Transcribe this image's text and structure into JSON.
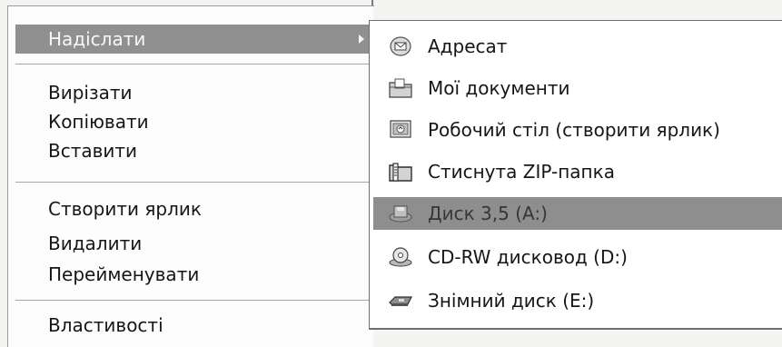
{
  "context_menu": {
    "send_to_label": "Надіслати",
    "cut_label": "Вирізати",
    "copy_label": "Копіювати",
    "paste_label": "Вставити",
    "create_shortcut_label": "Створити ярлик",
    "delete_label": "Видалити",
    "rename_label": "Перейменувати",
    "properties_label": "Властивості"
  },
  "send_to_submenu": {
    "items": [
      {
        "label": "Адресат",
        "icon": "mail-recipient-icon"
      },
      {
        "label": "Мої документи",
        "icon": "folder-icon"
      },
      {
        "label": "Робочий стіл (створити ярлик)",
        "icon": "desktop-icon"
      },
      {
        "label": "Стиснута  ZIP-папка",
        "icon": "zip-folder-icon"
      },
      {
        "label": "Диск 3,5 (A:)",
        "icon": "floppy-drive-icon"
      },
      {
        "label": "CD-RW дисковод (D:)",
        "icon": "cd-drive-icon"
      },
      {
        "label": "Знімний диск (E:)",
        "icon": "removable-disk-icon"
      }
    ],
    "highlighted_index": 4
  }
}
